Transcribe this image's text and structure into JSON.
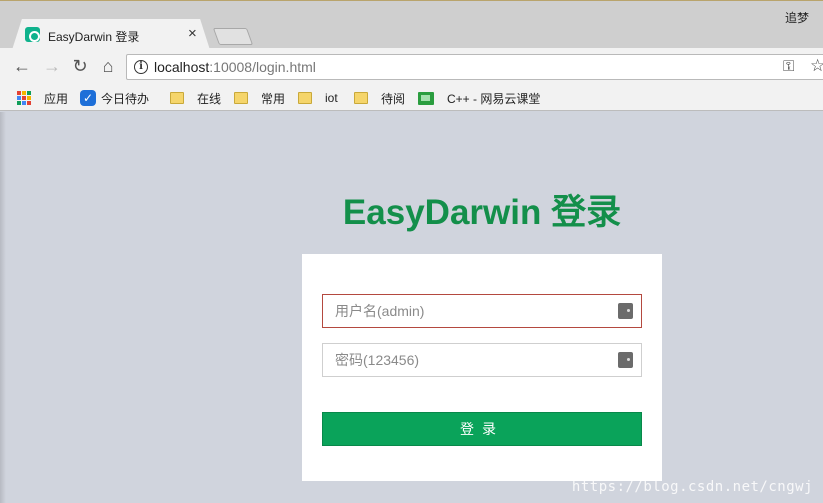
{
  "browser": {
    "tab_title": "EasyDarwin 登录",
    "tab_close": "×",
    "user_name": "追梦",
    "url_host": "localhost",
    "url_rest": ":10008/login.html"
  },
  "nav": {
    "back": "←",
    "forward": "→",
    "reload": "↻",
    "home": "⌂",
    "info": "i",
    "key": "⚿",
    "star": "☆"
  },
  "bookmarks": [
    {
      "label": "应用",
      "icon": "apps-icon"
    },
    {
      "label": "今日待办",
      "icon": "check-icon"
    },
    {
      "label": "在线",
      "icon": "folder-icon"
    },
    {
      "label": "常用",
      "icon": "folder-icon"
    },
    {
      "label": "iot",
      "icon": "folder-icon"
    },
    {
      "label": "待阅",
      "icon": "folder-icon"
    },
    {
      "label": "C++ - 网易云课堂",
      "icon": "mooc-icon"
    }
  ],
  "login": {
    "title": "EasyDarwin 登录",
    "username_placeholder": "用户名(admin)",
    "password_placeholder": "密码(123456)",
    "submit": "登录"
  },
  "watermark": "https://blog.csdn.net/cngwj",
  "colors": {
    "brand_green": "#138f4a",
    "button_green": "#0aa35a",
    "page_bg": "#d0d4dd",
    "error_border": "#b4493f"
  }
}
